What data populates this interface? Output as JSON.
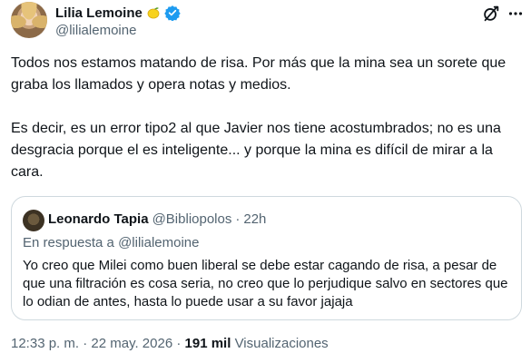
{
  "author": {
    "name": "Lilia Lemoine",
    "handle": "@lilialemoine",
    "emoji_icon": "lemon-icon",
    "verified_icon": "verified-badge-icon"
  },
  "header_actions": {
    "grok_icon": "grok-icon",
    "more_icon": "more-options-icon"
  },
  "tweet": {
    "paragraph1": "Todos nos estamos matando de risa. Por más que la mina sea un sorete que graba los llamados y opera notas y medios.",
    "paragraph2": "Es decir, es un error tipo2 al que Javier nos tiene acostumbrados; no es una desgracia porque el es inteligente... y porque la mina es difícil de mirar a la cara."
  },
  "quote": {
    "name": "Leonardo Tapia",
    "handle": "@Bibliopolos",
    "separator": "·",
    "time": "22h",
    "reply_context": "En respuesta a @lilialemoine",
    "text": "Yo creo que Milei como buen liberal se debe estar cagando de risa, a pesar de que una filtración es cosa seria, no creo que lo perjudique salvo en sectores que lo odian de antes, hasta lo puede usar a su favor jajaja"
  },
  "meta": {
    "time": "12:33 p. m.",
    "separator": "·",
    "date": "22 may. 2026",
    "separator2": "·",
    "views_count": "191 mil",
    "views_label": "Visualizaciones"
  },
  "colors": {
    "text": "#0f1419",
    "secondary": "#536471",
    "border": "#cfd9de",
    "verified": "#1d9bf0"
  }
}
